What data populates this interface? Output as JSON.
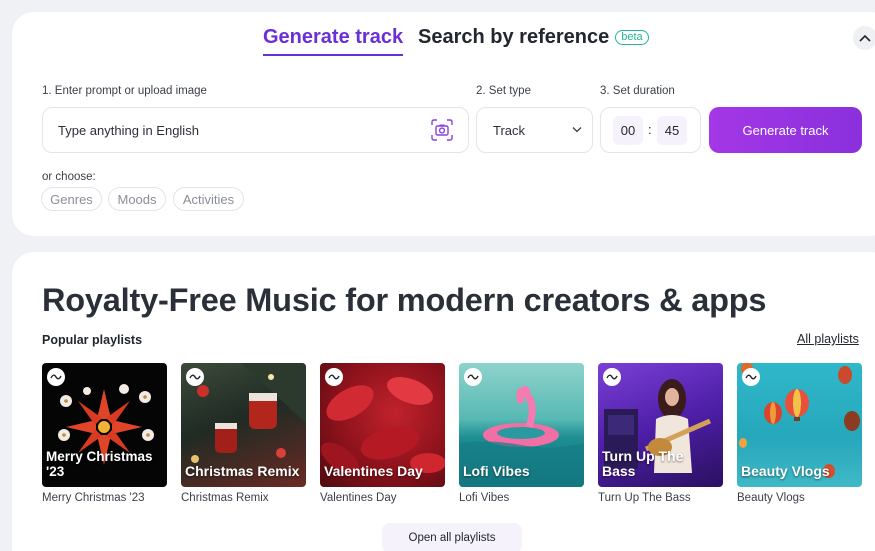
{
  "tabs": {
    "generate": "Generate track",
    "search": "Search by reference",
    "beta": "beta"
  },
  "form": {
    "prompt_label": "1. Enter prompt or upload image",
    "prompt_placeholder": "Type anything in English",
    "type_label": "2. Set type",
    "type_value": "Track",
    "duration_label": "3. Set duration",
    "duration_minutes": "00",
    "duration_separator": ":",
    "duration_seconds": "45",
    "generate_button": "Generate track",
    "or_choose": "or choose:",
    "chips": [
      "Genres",
      "Moods",
      "Activities"
    ]
  },
  "main": {
    "hero_title": "Royalty-Free Music for modern creators & apps",
    "popular_label": "Popular playlists",
    "all_playlists": "All playlists",
    "open_all": "Open all playlists"
  },
  "playlists": [
    {
      "title": "Merry Christmas '23",
      "caption": "Merry Christmas '23"
    },
    {
      "title": "Christmas Remix",
      "caption": "Christmas Remix"
    },
    {
      "title": "Valentines Day",
      "caption": "Valentines Day"
    },
    {
      "title": "Lofi Vibes",
      "caption": "Lofi Vibes"
    },
    {
      "title": "Turn Up The Bass",
      "caption": "Turn Up The Bass"
    },
    {
      "title": "Beauty Vlogs",
      "caption": "Beauty Vlogs"
    }
  ],
  "icons": {
    "camera": "camera-icon",
    "chevron_down": "chevron-down-icon",
    "chevron_up": "chevron-up-icon",
    "wave": "wave-icon"
  },
  "colors": {
    "accent": "#6b2fd6",
    "button_gradient_start": "#a437e6",
    "button_gradient_end": "#8a30dc",
    "beta": "#23b59a"
  }
}
